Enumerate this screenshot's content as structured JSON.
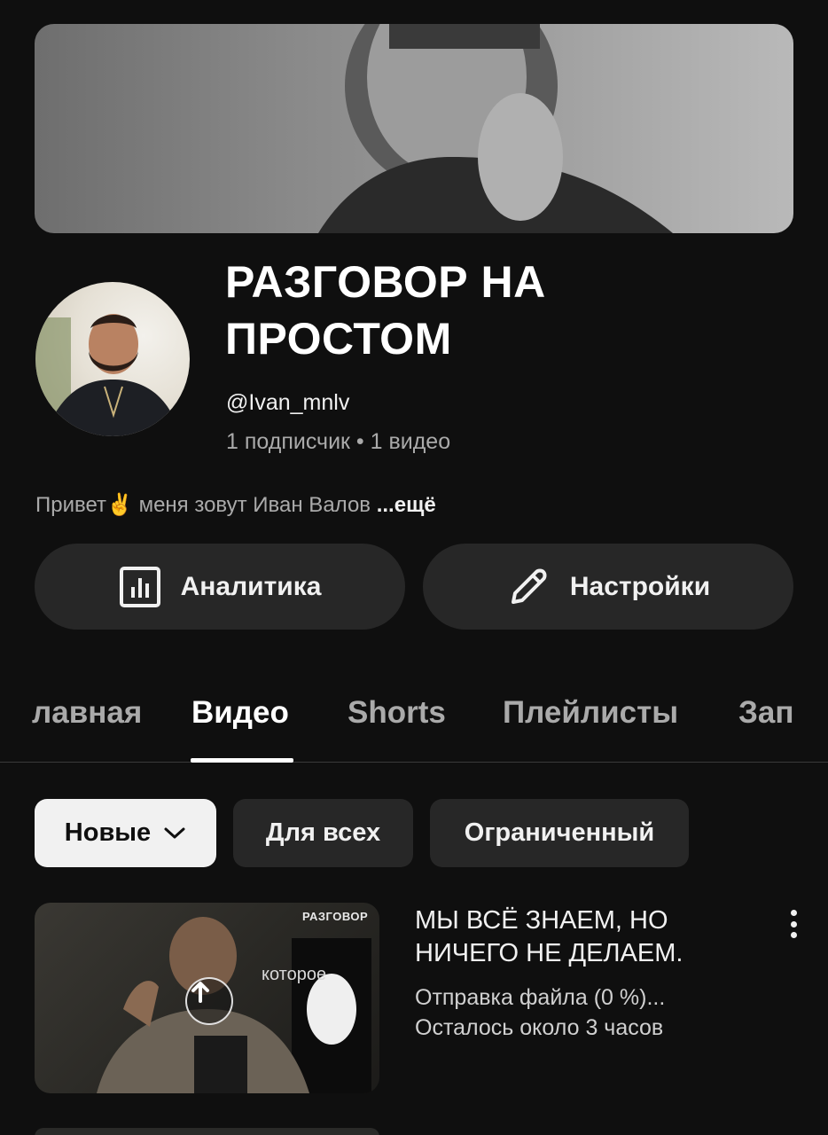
{
  "channel": {
    "title": "РАЗГОВОР НА ПРОСТОМ",
    "handle": "@Ivan_mnlv",
    "stats": "1 подписчик • 1 видео",
    "description": "Привет✌️ меня зовут Иван Валов",
    "description_more": "...ещё"
  },
  "actions": {
    "analytics_label": "Аналитика",
    "settings_label": "Настройки"
  },
  "tabs": [
    {
      "label": "Главная",
      "active": false
    },
    {
      "label": "Видео",
      "active": true
    },
    {
      "label": "Shorts",
      "active": false
    },
    {
      "label": "Плейлисты",
      "active": false
    },
    {
      "label": "Записи",
      "active": false
    }
  ],
  "tabs_visible": [
    "лавная",
    "Видео",
    "Shorts",
    "Плейлисты",
    "Зап"
  ],
  "filters": {
    "sort_label": "Новые",
    "audience_all": "Для всех",
    "restricted": "Ограниченный"
  },
  "video": {
    "title": "МЫ ВСЁ ЗНАЕМ, НО НИЧЕГО НЕ ДЕЛАЕМ.",
    "status_line1": "Отправка файла (0 %)...",
    "status_line2": "Осталось около 3 часов",
    "thumb_caption": "которое",
    "thumb_brand": "РАЗГОВОР",
    "upload_progress": 0
  },
  "colors": {
    "background": "#0f0f0f",
    "surface": "#272727",
    "chip_selected": "#f1f1f1",
    "text_primary": "#f1f1f1",
    "text_secondary": "#aaaaaa"
  },
  "icons": [
    "analytics-icon",
    "pencil-icon",
    "chevron-down-icon",
    "upload-arrow-icon",
    "more-vert-icon"
  ]
}
